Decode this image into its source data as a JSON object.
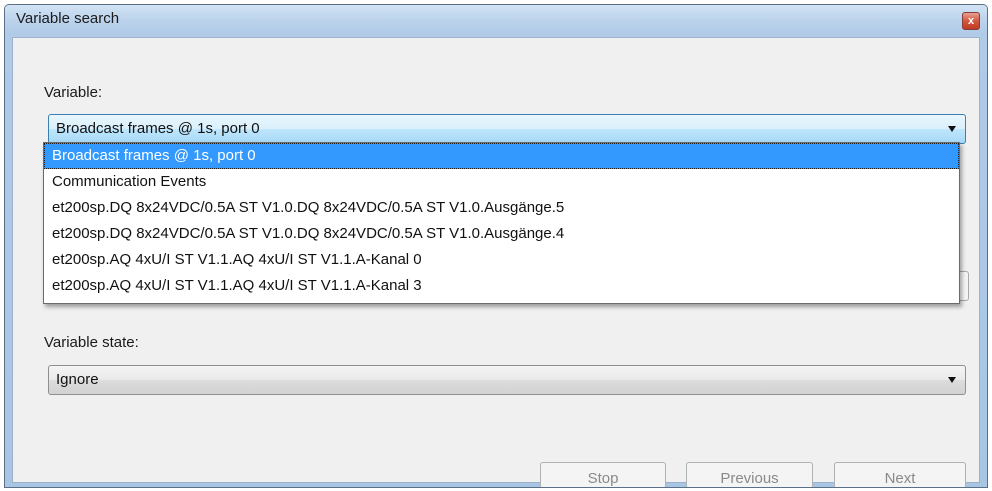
{
  "window": {
    "title": "Variable search",
    "close_glyph": "x"
  },
  "variable": {
    "label": "Variable:",
    "selected": "Broadcast frames @ 1s, port 0",
    "options": [
      "Broadcast frames @ 1s, port 0",
      "Communication Events",
      "et200sp.DQ 8x24VDC/0.5A ST V1.0.DQ 8x24VDC/0.5A ST V1.0.Ausgänge.5",
      "et200sp.DQ 8x24VDC/0.5A ST V1.0.DQ 8x24VDC/0.5A ST V1.0.Ausgänge.4",
      "et200sp.AQ 4xU/I ST V1.1.AQ 4xU/I ST V1.1.A-Kanal 0",
      "et200sp.AQ 4xU/I ST V1.1.AQ 4xU/I ST V1.1.A-Kanal 3"
    ]
  },
  "variable_state": {
    "label": "Variable state:",
    "selected": "Ignore"
  },
  "buttons": {
    "stop": "Stop",
    "previous": "Previous",
    "next": "Next"
  },
  "colors": {
    "selection": "#3399ff",
    "error_border": "#e03c3c",
    "close_button": "#c03a24"
  },
  "icons": {
    "close": "close-icon",
    "dropdown_arrow": "chevron-down-icon"
  }
}
